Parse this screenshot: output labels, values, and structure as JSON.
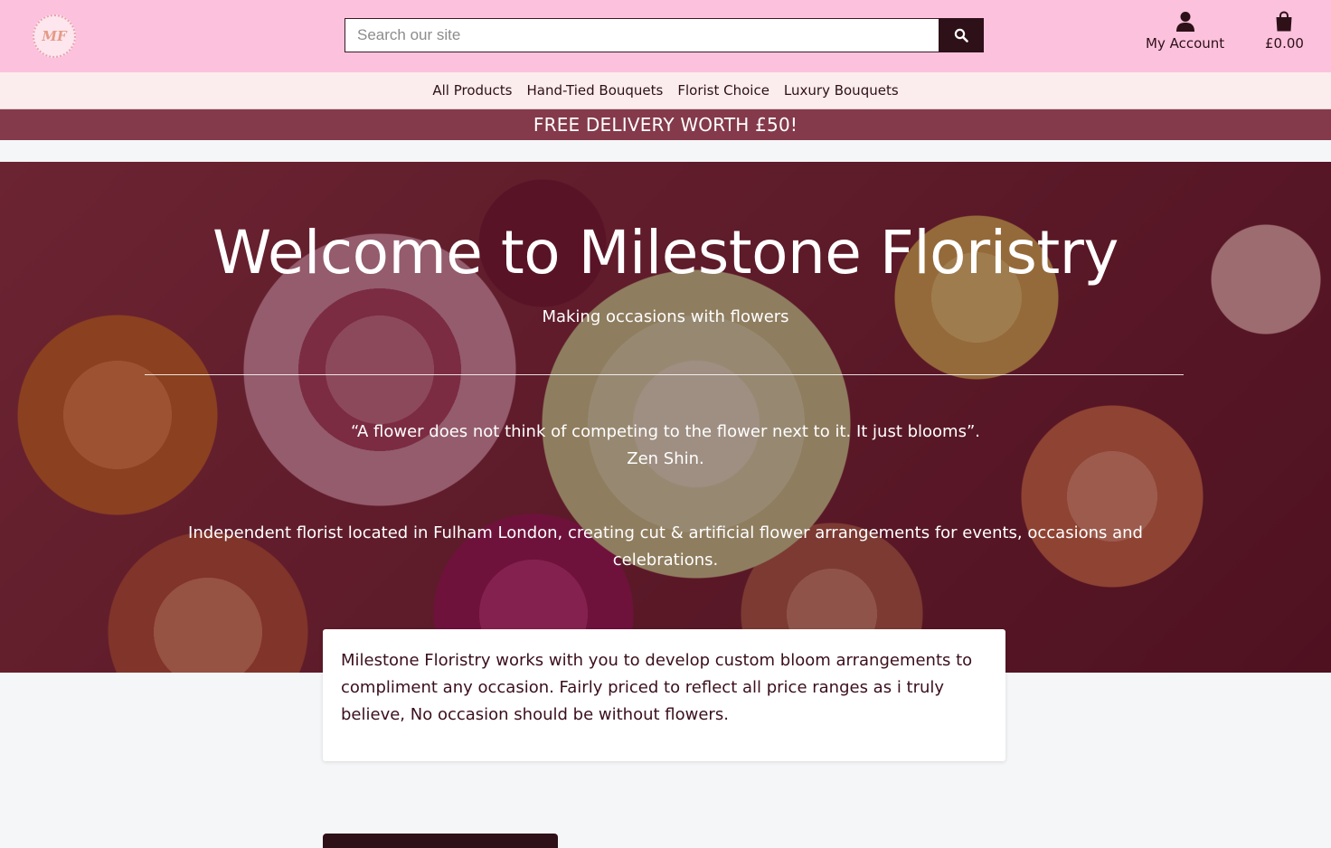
{
  "header": {
    "logo_text": "MF",
    "search_placeholder": "Search our site",
    "account_label": "My Account",
    "basket_total": "£0.00"
  },
  "nav": {
    "items": [
      "All Products",
      "Hand-Tied Bouquets",
      "Florist Choice",
      "Luxury Bouquets"
    ]
  },
  "promo": {
    "text": "FREE DELIVERY WORTH £50!"
  },
  "hero": {
    "title": "Welcome to Milestone Floristry",
    "subtitle": "Making occasions with flowers",
    "quote": "“A flower does not think of competing to the flower next to it. It just blooms”.",
    "quote_author": "Zen Shin.",
    "description": "Independent florist located in Fulham London, creating cut & artificial flower arrangements for events, occasions and celebrations."
  },
  "info_card": {
    "text": "Milestone Floristry works with you to develop custom bloom arrangements to compliment any occasion. Fairly priced to reflect all price ranges as i truly believe, No occasion should be without flowers."
  },
  "colors": {
    "topbar": "#fcc2dd",
    "nav_bg": "#fbeded",
    "promo_bg": "#843a4a",
    "dark_accent": "#2e1018"
  },
  "icons": {
    "search": "search-icon",
    "account": "user-icon",
    "basket": "shopping-bag-icon"
  }
}
